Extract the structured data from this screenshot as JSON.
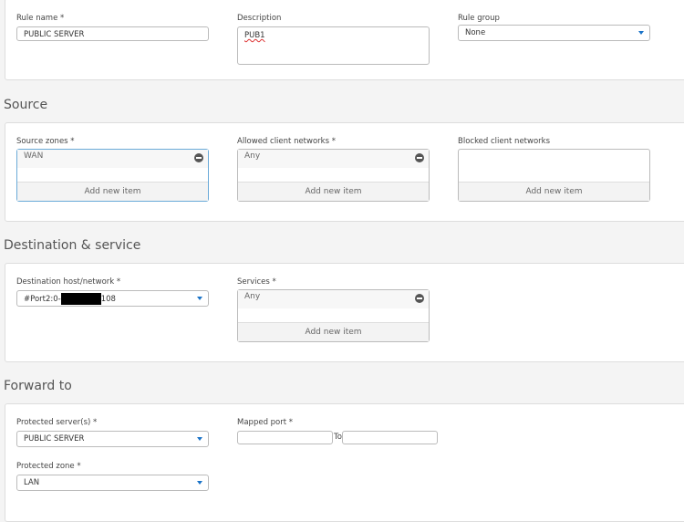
{
  "general": {
    "rule_name_label": "Rule name *",
    "rule_name_value": "PUBLIC SERVER",
    "description_label": "Description",
    "description_value": "PUB1",
    "rule_group_label": "Rule group",
    "rule_group_value": "None"
  },
  "source": {
    "heading": "Source",
    "zones_label": "Source zones *",
    "zones_items": [
      "WAN"
    ],
    "allowed_label": "Allowed client networks *",
    "allowed_items": [
      "Any"
    ],
    "blocked_label": "Blocked client networks",
    "add_label": "Add new item"
  },
  "destination": {
    "heading": "Destination & service",
    "host_label": "Destination host/network *",
    "host_value_prefix": "#Port2:0-",
    "host_value_suffix": "108",
    "services_label": "Services *",
    "services_items": [
      "Any"
    ],
    "add_label": "Add new item"
  },
  "forward": {
    "heading": "Forward to",
    "servers_label": "Protected server(s) *",
    "servers_value": "PUBLIC SERVER",
    "mapped_port_label": "Mapped port *",
    "to_label": "To",
    "zone_label": "Protected zone *",
    "zone_value": "LAN"
  },
  "colors": {
    "accent": "#1a73c8",
    "focus": "#6aaad8"
  }
}
